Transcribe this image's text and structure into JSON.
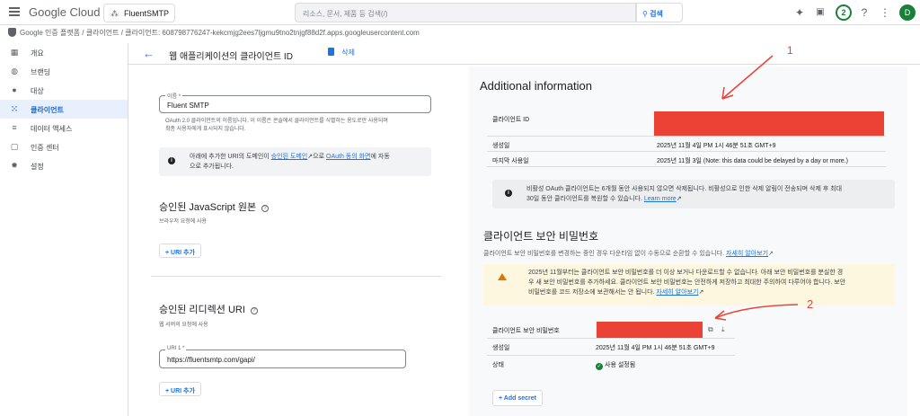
{
  "topbar": {
    "logo_text": "Google Cloud",
    "project": "FluentSMTP",
    "search_placeholder": "리소스, 문서, 제품 등 검색(/)",
    "search_button": "검색",
    "notification_count": "2",
    "avatar_letter": "D"
  },
  "breadcrumb": "Google 인증 플랫폼 / 클라이언트 / 클라이언트: 608798776247-kekcmjg2ees7ljgmu9tno2tnjgf88d2f.apps.googleusercontent.com",
  "sidebar": {
    "items": [
      {
        "label": "개요",
        "icon": "grid-icon"
      },
      {
        "label": "브랜딩",
        "icon": "palette-icon"
      },
      {
        "label": "대상",
        "icon": "person-icon"
      },
      {
        "label": "클라이언트",
        "icon": "apps-icon"
      },
      {
        "label": "데이터 액세스",
        "icon": "list-icon"
      },
      {
        "label": "인증 센터",
        "icon": "badge-icon"
      },
      {
        "label": "설정",
        "icon": "gear-icon"
      }
    ]
  },
  "header": {
    "title": "웹 애플리케이션의 클라이언트 ID",
    "delete_label": "삭제"
  },
  "form": {
    "name_label": "이름 *",
    "name_value": "Fluent SMTP",
    "name_help_1": "OAuth 2.0 클라이언트의 이름입니다. 이 이름은 콘솔에서 클라이언트를 식별하는 용도로만 사용되며",
    "name_help_2": "최종 사용자에게 표시되지 않습니다.",
    "info_text_1": "아래에 추가한 URI의 도메인이",
    "info_link_1": "승인된 도메인",
    "info_text_2": "으로",
    "info_link_2": "OAuth 동의 화면",
    "info_text_3": "에 자동",
    "info_text_4": "으로 추가됩니다.",
    "js_origins_title": "승인된 JavaScript 원본",
    "js_origins_help": "브라우저 요청에 사용",
    "add_uri_label": "+ URI 추가",
    "redirect_title": "승인된 리디렉션 URI",
    "redirect_help": "웹 서버의 요청에 사용",
    "uri1_label": "URI 1 *",
    "uri1_value": "https://fluentsmtp.com/gapi/"
  },
  "additional": {
    "title": "Additional information",
    "rows": [
      {
        "key": "클라이언트 ID",
        "value": ""
      },
      {
        "key": "생성일",
        "value": "2025년 11월 4일 PM 1시 46분 51초 GMT+9"
      },
      {
        "key": "마지막 사용일",
        "value": "2025년 11월 3일 (Note: this data could be delayed by a day or more.)"
      }
    ],
    "inactive_note_1": "비활성 OAuth 클라이언트는 6개월 동안 사용되지 않으면 삭제됩니다. 비활성으로 인한 삭제 알림이 전송되며 삭제 후 최대",
    "inactive_note_2": "30일 동안 클라이언트를 복원할 수 있습니다.",
    "learn_more": "Learn more"
  },
  "secret": {
    "title": "클라이언트 보안 비밀번호",
    "desc": "클라이언트 보안 비밀번호를 변경하는 중인 경우 다운타임 없이 수동으로 순환할 수 있습니다.",
    "desc_link": "자세히 알아보기",
    "warn_1": "2025년 11월부터는 클라이언트 보안 비밀번호를 더 이상 보거나 다운로드할 수 없습니다. 아래 보안 비밀번호를 분실한 경",
    "warn_2": "우 새 보안 비밀번호를 추가하세요. 클라이언트 보안 비밀번호는 안전하게 저장하고 최대한 주의하여 다루어야 합니다. 보안",
    "warn_3": "비밀번호를 코드 저장소에 보관해서는 안 됩니다.",
    "warn_link": "자세히 알아보기",
    "rows": [
      {
        "key": "클라이언트 보안 비밀번호",
        "value": ""
      },
      {
        "key": "생성일",
        "value": "2025년 11월 4일 PM 1시 46분 51초 GMT+9"
      },
      {
        "key": "상태",
        "value": "사용 설정됨"
      }
    ],
    "add_secret": "+ Add secret"
  },
  "annotations": {
    "mark_1": "1",
    "mark_2": "2",
    "color": "#ea4335"
  },
  "colors": {
    "accent": "#1a73e8",
    "redaction": "#ea4335",
    "active_nav_bg": "#e8f0fe"
  }
}
